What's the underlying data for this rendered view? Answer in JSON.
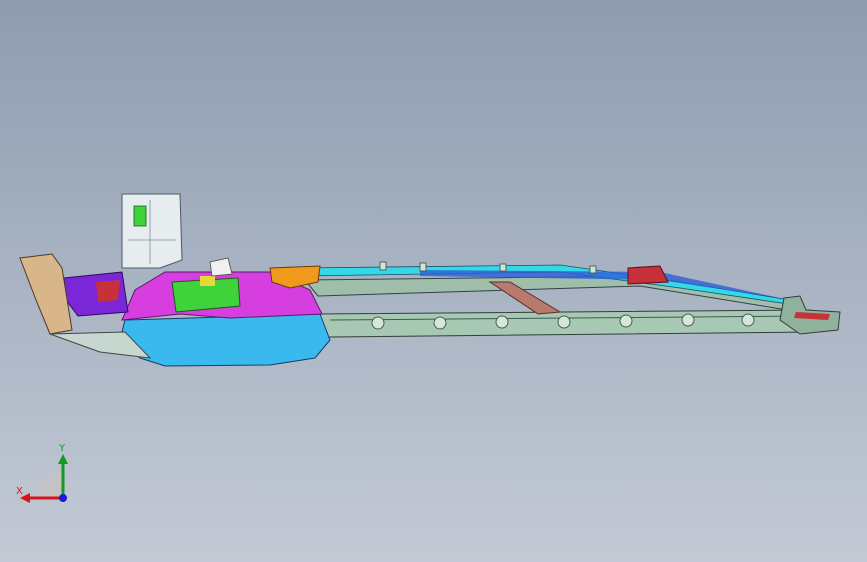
{
  "viewport": {
    "colors": {
      "background_top": "#8f9caf",
      "background_bottom": "#c3cad5"
    }
  },
  "model": {
    "icon": "car-underbody-assembly",
    "part_colors": {
      "rail": "#a7c9b4",
      "floor_blue": "#3ab9ee",
      "floor_magenta": "#d63ee0",
      "green": "#3fd23a",
      "purple": "#7b27d8",
      "orange": "#f09a1c",
      "tan": "#d9b58a",
      "red": "#c8303a",
      "cyan": "#34d8e6"
    }
  },
  "triad": {
    "icon": "xyz-axis-triad",
    "x_label": "X",
    "y_label": "Y",
    "colors": {
      "x": "#d8141a",
      "y": "#129a26",
      "z": "#1a1ad8"
    }
  }
}
